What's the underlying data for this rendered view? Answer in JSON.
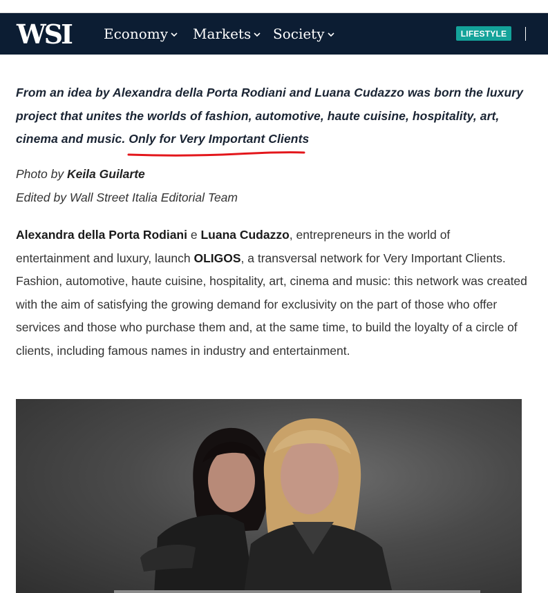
{
  "header": {
    "logo": "WSI",
    "nav": [
      {
        "label": "Economy"
      },
      {
        "label": "Markets"
      },
      {
        "label": "Society"
      }
    ],
    "badge": "LIFESTYLE",
    "badge_color": "#14a39a",
    "navbar_color": "#0c1d33"
  },
  "article": {
    "lead_main": "From an idea by Alexandra della Porta Rodiani and Luana Cudazzo was born the luxury project that unites the worlds of fashion, automotive, haute cuisine, hospitality, art, cinema and music. ",
    "lead_highlight": "Only for Very Important Clients",
    "highlight_color": "#e3161b",
    "credit_photo_prefix": "Photo by ",
    "credit_photo_name": "Keila Guilarte",
    "credit_edited": "Edited by Wall Street Italia Editorial Team",
    "body": {
      "name1": "Alexandra della Porta Rodiani",
      "conj": " e ",
      "name2": "Luana Cudazzo",
      "part1": ", entrepreneurs in the world of entertainment and luxury, launch ",
      "brand": "OLIGOS",
      "part2": ", a transversal network for Very Important Clients. Fashion, automotive, haute cuisine, hospitality, art, cinema and music: this network was created with the aim of satisfying the growing demand for exclusivity on the part of those who offer services and those who purchase them and, at the same time, to build the loyalty of a circle of clients, including famous names in industry and entertainment."
    },
    "photo": "photo of two women in black leather jackets"
  }
}
